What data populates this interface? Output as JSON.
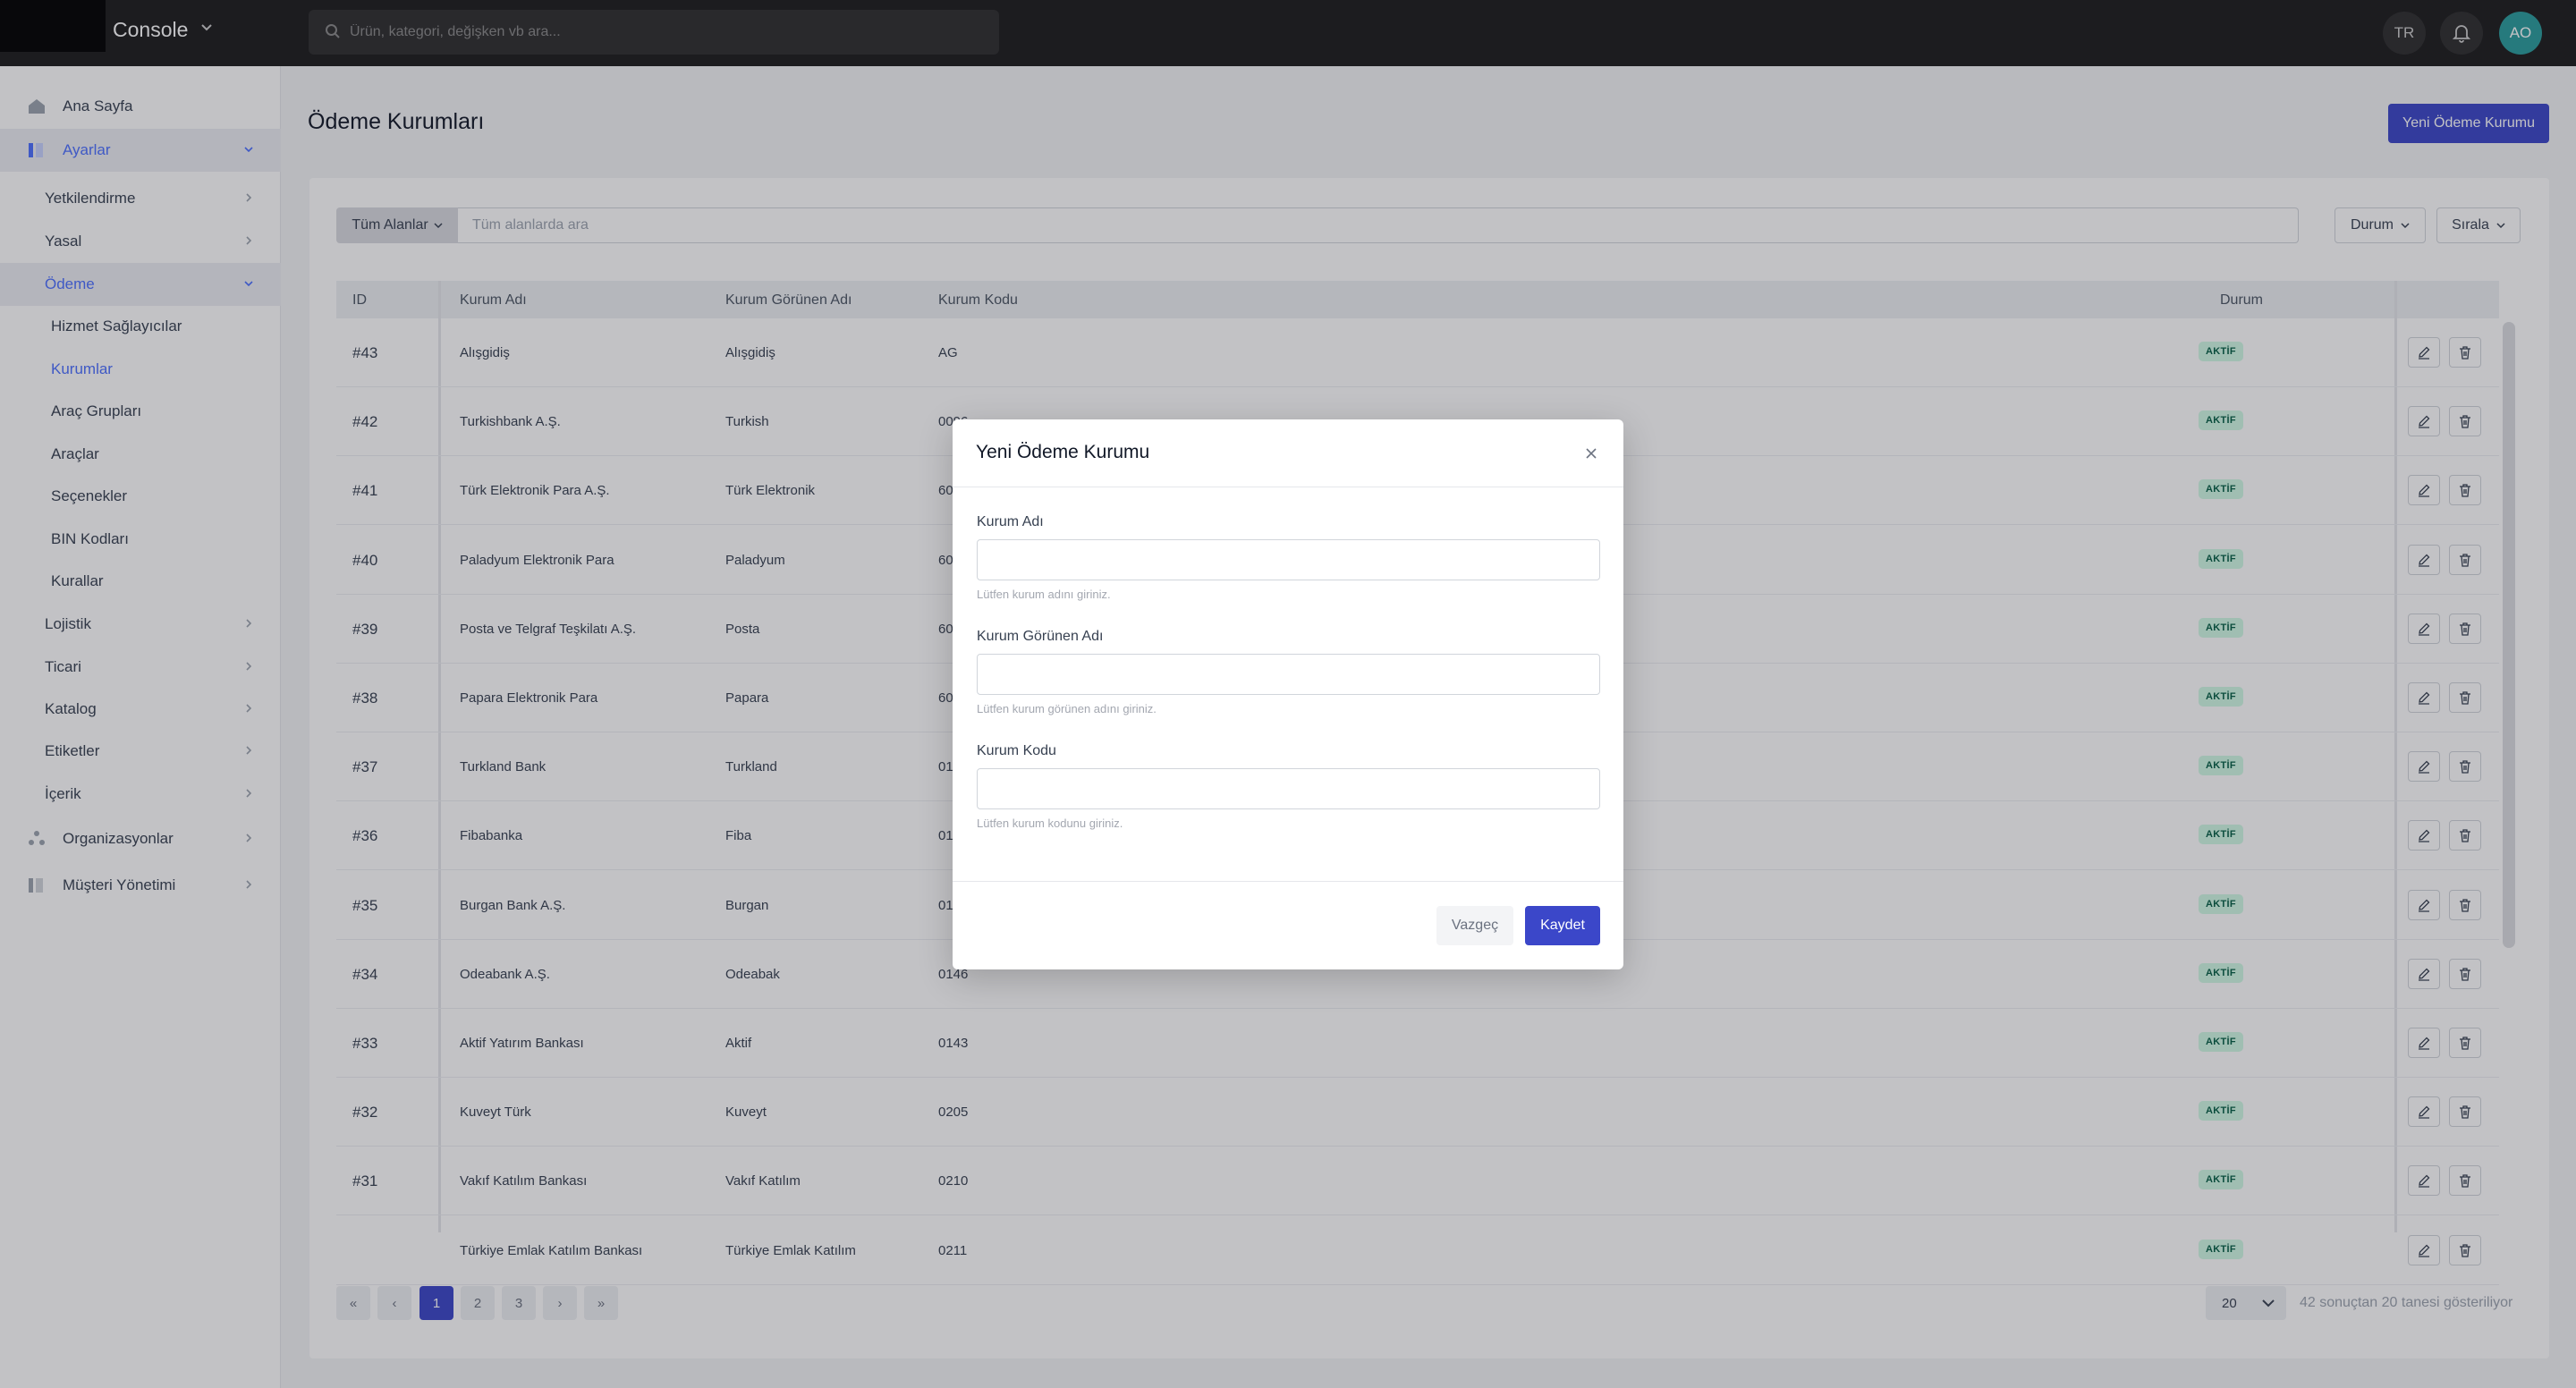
{
  "app": {
    "name": "Console"
  },
  "search": {
    "placeholder": "Ürün, kategori, değişken vb ara..."
  },
  "topbar": {
    "language": "TR",
    "avatar_initials": "AO"
  },
  "sidebar": {
    "home": "Ana Sayfa",
    "settings": "Ayarlar",
    "sub": {
      "auth": "Yetkilendirme",
      "legal": "Yasal",
      "payment": "Ödeme",
      "payment_items": [
        "Hizmet Sağlayıcılar",
        "Kurumlar",
        "Araç Grupları",
        "Araçlar",
        "Seçenekler",
        "BIN Kodları",
        "Kurallar"
      ],
      "logistics": "Lojistik",
      "commerce": "Ticari",
      "catalog": "Katalog",
      "tags": "Etiketler",
      "content": "İçerik"
    },
    "organizations": "Organizasyonlar",
    "customer_management": "Müşteri Yönetimi"
  },
  "page": {
    "title": "Ödeme Kurumları",
    "new_button": "Yeni Ödeme Kurumu"
  },
  "filters": {
    "field_select": "Tüm Alanlar",
    "search_placeholder": "Tüm alanlarda ara",
    "status": "Durum",
    "sort": "Sırala"
  },
  "table": {
    "columns": [
      "ID",
      "Kurum Adı",
      "Kurum Görünen Adı",
      "Kurum Kodu",
      "Durum"
    ],
    "rows": [
      {
        "id": "#43",
        "name": "Alışgidiş",
        "display": "Alışgidiş",
        "code": "AG",
        "status": "AKTİF"
      },
      {
        "id": "#42",
        "name": "Turkishbank A.Ş.",
        "display": "Turkish",
        "code": "0096",
        "status": "AKTİF"
      },
      {
        "id": "#41",
        "name": "Türk Elektronik Para A.Ş.",
        "display": "Türk Elektronik",
        "code": "60",
        "status": "AKTİF"
      },
      {
        "id": "#40",
        "name": "Paladyum Elektronik Para",
        "display": "Paladyum",
        "code": "60",
        "status": "AKTİF"
      },
      {
        "id": "#39",
        "name": "Posta ve Telgraf Teşkilatı A.Ş.",
        "display": "Posta",
        "code": "60",
        "status": "AKTİF"
      },
      {
        "id": "#38",
        "name": "Papara Elektronik Para",
        "display": "Papara",
        "code": "60",
        "status": "AKTİF"
      },
      {
        "id": "#37",
        "name": "Turkland Bank",
        "display": "Turkland",
        "code": "01",
        "status": "AKTİF"
      },
      {
        "id": "#36",
        "name": "Fibabanka",
        "display": "Fiba",
        "code": "01",
        "status": "AKTİF"
      },
      {
        "id": "#35",
        "name": "Burgan Bank A.Ş.",
        "display": "Burgan",
        "code": "01",
        "status": "AKTİF"
      },
      {
        "id": "#34",
        "name": "Odeabank A.Ş.",
        "display": "Odeabak",
        "code": "0146",
        "status": "AKTİF"
      },
      {
        "id": "#33",
        "name": "Aktif Yatırım Bankası",
        "display": "Aktif",
        "code": "0143",
        "status": "AKTİF"
      },
      {
        "id": "#32",
        "name": "Kuveyt Türk",
        "display": "Kuveyt",
        "code": "0205",
        "status": "AKTİF"
      },
      {
        "id": "#31",
        "name": "Vakıf Katılım Bankası",
        "display": "Vakıf Katılım",
        "code": "0210",
        "status": "AKTİF"
      },
      {
        "id": "",
        "name": "Türkiye Emlak Katılım Bankası",
        "display": "Türkiye Emlak Katılım",
        "code": "0211",
        "status": "AKTİF"
      }
    ]
  },
  "pagination": {
    "pages": [
      "1",
      "2",
      "3"
    ],
    "current": "1",
    "page_size": "20",
    "info": "42 sonuçtan 20 tanesi gösteriliyor"
  },
  "modal": {
    "title": "Yeni Ödeme Kurumu",
    "fields": [
      {
        "label": "Kurum Adı",
        "hint": "Lütfen kurum adını giriniz.",
        "value": ""
      },
      {
        "label": "Kurum Görünen Adı",
        "hint": "Lütfen kurum görünen adını giriniz.",
        "value": ""
      },
      {
        "label": "Kurum Kodu",
        "hint": "Lütfen kurum kodunu giriniz.",
        "value": ""
      }
    ],
    "cancel": "Vazgeç",
    "save": "Kaydet"
  },
  "colors": {
    "accent": "#3b47c9",
    "active_nav": "#4c6fff",
    "badge_bg": "#d1fae5",
    "badge_text": "#065f46"
  }
}
